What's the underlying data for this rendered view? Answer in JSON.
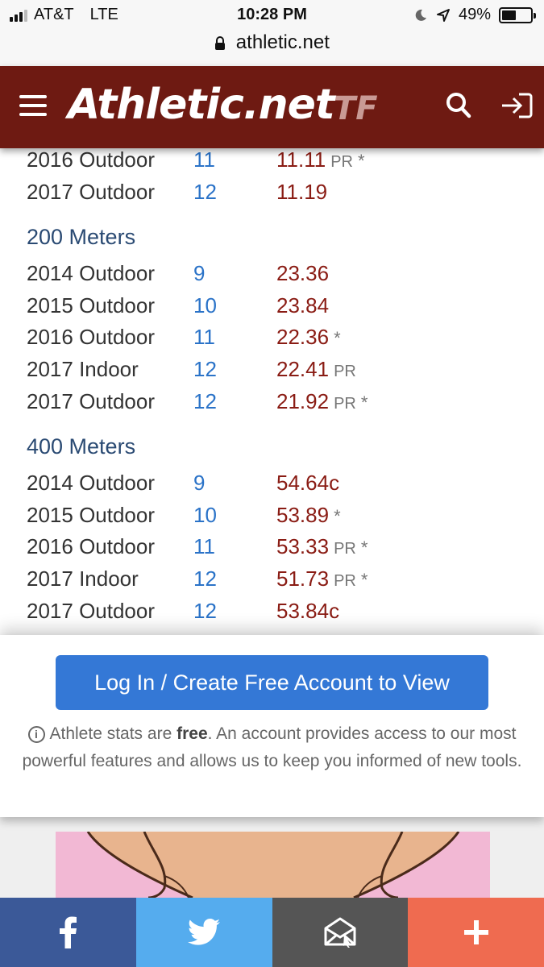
{
  "status_bar": {
    "carrier": "AT&T",
    "network": "LTE",
    "time": "10:28 PM",
    "battery": "49%",
    "battery_level": 0.49
  },
  "url_bar": {
    "domain": "athletic.net"
  },
  "header": {
    "logo": "Athletic.net",
    "sport": "TF"
  },
  "partial_event": {
    "rows": [
      {
        "season": "2016 Outdoor",
        "grade": "11",
        "mark": "11.11",
        "pr": "PR",
        "star": "*"
      },
      {
        "season": "2017 Outdoor",
        "grade": "12",
        "mark": "11.19",
        "pr": "",
        "star": ""
      }
    ]
  },
  "events": [
    {
      "title": "200 Meters",
      "rows": [
        {
          "season": "2014 Outdoor",
          "grade": "9",
          "mark": "23.36",
          "pr": "",
          "star": ""
        },
        {
          "season": "2015 Outdoor",
          "grade": "10",
          "mark": "23.84",
          "pr": "",
          "star": ""
        },
        {
          "season": "2016 Outdoor",
          "grade": "11",
          "mark": "22.36",
          "pr": "",
          "star": "*"
        },
        {
          "season": "2017 Indoor",
          "grade": "12",
          "mark": "22.41",
          "pr": "PR",
          "star": ""
        },
        {
          "season": "2017 Outdoor",
          "grade": "12",
          "mark": "21.92",
          "pr": "PR",
          "star": "*"
        }
      ]
    },
    {
      "title": "400 Meters",
      "rows": [
        {
          "season": "2014 Outdoor",
          "grade": "9",
          "mark": "54.64c",
          "pr": "",
          "star": ""
        },
        {
          "season": "2015 Outdoor",
          "grade": "10",
          "mark": "53.89",
          "pr": "",
          "star": "*"
        },
        {
          "season": "2016 Outdoor",
          "grade": "11",
          "mark": "53.33",
          "pr": "PR",
          "star": "*"
        },
        {
          "season": "2017 Indoor",
          "grade": "12",
          "mark": "51.73",
          "pr": "PR",
          "star": "*"
        },
        {
          "season": "2017 Outdoor",
          "grade": "12",
          "mark": "53.84c",
          "pr": "",
          "star": ""
        }
      ]
    }
  ],
  "login_panel": {
    "button_label": "Log In / Create Free Account to View",
    "note_prefix": "Athlete stats are ",
    "note_bold": "free",
    "note_suffix": ". An account provides access to our most powerful features and allows us to keep you informed of new tools."
  },
  "share_bar": {
    "buttons": [
      "facebook-icon",
      "twitter-icon",
      "email-icon",
      "plus-icon"
    ]
  },
  "colors": {
    "header_bg": "#6e1a12",
    "event_title": "#2a4a73",
    "grade": "#2b73c8",
    "mark": "#8a1c14",
    "login_button": "#3478d6",
    "facebook": "#3b5998",
    "twitter": "#55acee",
    "email": "#555555",
    "plus": "#ef6b50"
  }
}
